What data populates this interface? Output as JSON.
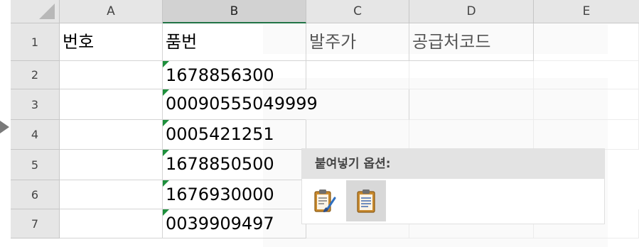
{
  "columns": [
    "A",
    "B",
    "C",
    "D",
    "E"
  ],
  "rows": [
    "1",
    "2",
    "3",
    "4",
    "5",
    "6",
    "7"
  ],
  "header_row": {
    "a": "번호",
    "b": "품번",
    "c": "발주가",
    "d": "공급처코드"
  },
  "values": {
    "b2": "1678856300",
    "b3": "00090555049999",
    "b4": "0005421251",
    "b5": "1678850500",
    "b6": "1676930000",
    "b7": "0039909497"
  },
  "paste_options": {
    "title": "붙여넣기 옵션:",
    "buttons": [
      {
        "name": "keep-source-formatting",
        "icon": "clipboard-paintbrush-icon"
      },
      {
        "name": "paste",
        "icon": "clipboard-icon"
      }
    ]
  },
  "colors": {
    "text_indicator": "#1e8f3c",
    "selected_accent": "#217346"
  }
}
